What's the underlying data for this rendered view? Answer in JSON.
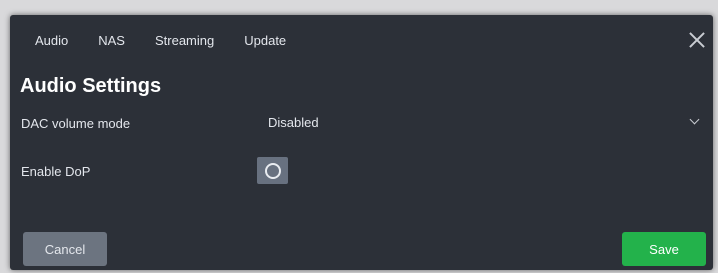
{
  "tabs": [
    {
      "label": "Audio"
    },
    {
      "label": "NAS"
    },
    {
      "label": "Streaming"
    },
    {
      "label": "Update"
    }
  ],
  "title": "Audio Settings",
  "settings": {
    "dac_volume_mode": {
      "label": "DAC volume mode",
      "value": "Disabled"
    },
    "enable_dop": {
      "label": "Enable DoP",
      "enabled": false
    }
  },
  "buttons": {
    "cancel": "Cancel",
    "save": "Save"
  },
  "colors": {
    "dialog_background": "#2c3038",
    "cancel_button": "#6c7480",
    "save_button": "#23b24b",
    "toggle_off": "#687180"
  },
  "icons": {
    "close": "close-icon",
    "dropdown": "chevron-down-icon",
    "toggle": "toggle-off-icon"
  }
}
